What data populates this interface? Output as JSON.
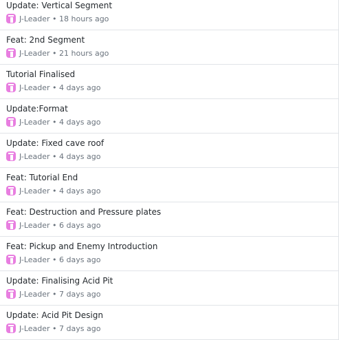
{
  "avatar_color": "#e87ee0",
  "commits": [
    {
      "title": "Update: Vertical Segment",
      "author": "J-Leader",
      "time": "18 hours ago"
    },
    {
      "title": "Feat: 2nd Segment",
      "author": "J-Leader",
      "time": "21 hours ago"
    },
    {
      "title": "Tutorial Finalised",
      "author": "J-Leader",
      "time": "4 days ago"
    },
    {
      "title": "Update:Format",
      "author": "J-Leader",
      "time": "4 days ago"
    },
    {
      "title": "Update: Fixed cave roof",
      "author": "J-Leader",
      "time": "4 days ago"
    },
    {
      "title": "Feat: Tutorial End",
      "author": "J-Leader",
      "time": "4 days ago"
    },
    {
      "title": "Feat: Destruction and Pressure plates",
      "author": "J-Leader",
      "time": "6 days ago"
    },
    {
      "title": "Feat: Pickup and Enemy Introduction",
      "author": "J-Leader",
      "time": "6 days ago"
    },
    {
      "title": "Update: Finalising Acid Pit",
      "author": "J-Leader",
      "time": "7 days ago"
    },
    {
      "title": "Update: Acid Pit Design",
      "author": "J-Leader",
      "time": "7 days ago"
    }
  ]
}
